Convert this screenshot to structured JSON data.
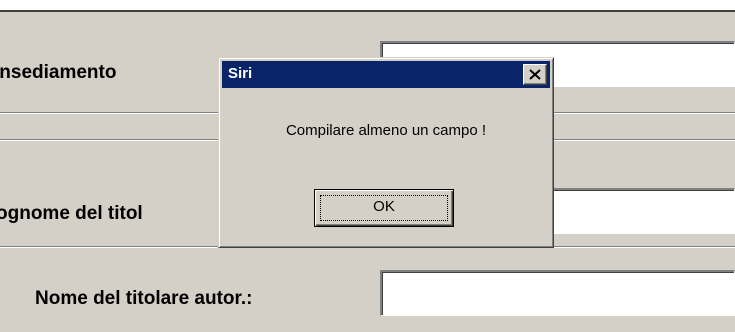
{
  "form": {
    "label_insediamento": "insediamento",
    "label_cognome": "ognome del titol",
    "label_nome": "Nome del titolare autor.:",
    "field_insediamento_value": "",
    "field_cognome_value": "",
    "field_nome_value": ""
  },
  "dialog": {
    "title": "Siri",
    "message": "Compilare almeno un campo !",
    "ok_label": "OK",
    "close_icon": "close-icon"
  },
  "colors": {
    "titlebar": "#0a246a",
    "window_face": "#d4d0c8"
  }
}
